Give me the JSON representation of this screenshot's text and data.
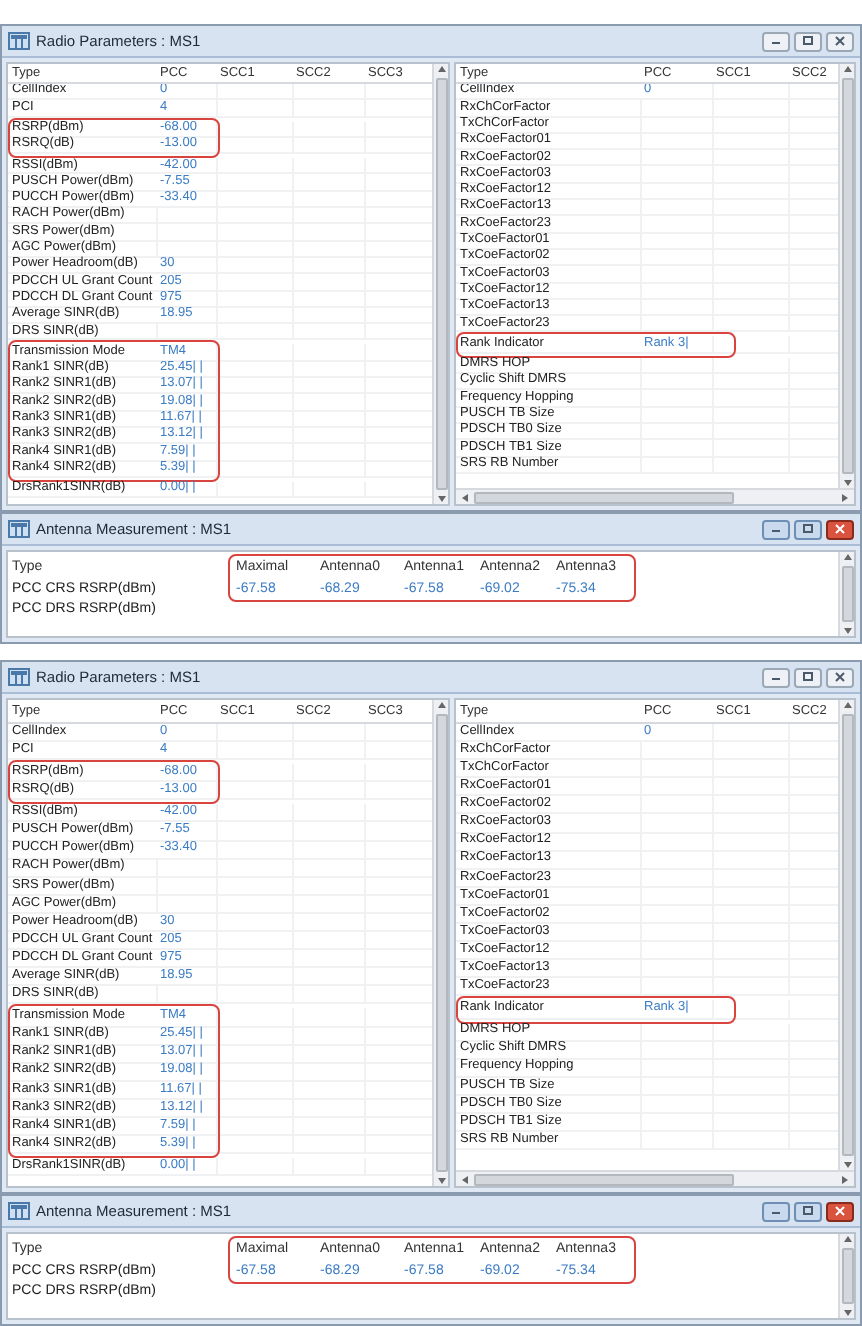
{
  "screens": [
    {
      "radio_parameters": {
        "title": "Radio Parameters : MS1",
        "left_table": {
          "columns": [
            "Type",
            "PCC",
            "SCC1",
            "SCC2",
            "SCC3"
          ],
          "sections": [
            {
              "highlighted": false,
              "rows": [
                {
                  "type": "CellIndex",
                  "pcc": "0"
                },
                {
                  "type": "PCI",
                  "pcc": "4"
                }
              ]
            },
            {
              "highlighted": true,
              "rows": [
                {
                  "type": "RSRP(dBm)",
                  "pcc": "-68.00"
                },
                {
                  "type": "RSRQ(dB)",
                  "pcc": "-13.00"
                }
              ]
            },
            {
              "highlighted": false,
              "rows": [
                {
                  "type": "RSSI(dBm)",
                  "pcc": "-42.00"
                },
                {
                  "type": "PUSCH Power(dBm)",
                  "pcc": "-7.55"
                },
                {
                  "type": "PUCCH Power(dBm)",
                  "pcc": "-33.40"
                },
                {
                  "type": "RACH Power(dBm)"
                },
                {
                  "type": "SRS Power(dBm)"
                },
                {
                  "type": "AGC Power(dBm)"
                },
                {
                  "type": "Power Headroom(dB)",
                  "pcc": "30"
                },
                {
                  "type": "PDCCH UL Grant Count",
                  "pcc": "205"
                },
                {
                  "type": "PDCCH DL Grant Count",
                  "pcc": "975"
                },
                {
                  "type": "Average SINR(dB)",
                  "pcc": "18.95"
                },
                {
                  "type": "DRS SINR(dB)"
                }
              ]
            },
            {
              "highlighted": true,
              "rows": [
                {
                  "type": "Transmission Mode",
                  "pcc": "TM4"
                },
                {
                  "type": "Rank1 SINR(dB)",
                  "pcc": "25.45| |"
                },
                {
                  "type": "Rank2 SINR1(dB)",
                  "pcc": "13.07| |"
                },
                {
                  "type": "Rank2 SINR2(dB)",
                  "pcc": "19.08| |"
                },
                {
                  "type": "Rank3 SINR1(dB)",
                  "pcc": "11.67| |"
                },
                {
                  "type": "Rank3 SINR2(dB)",
                  "pcc": "13.12| |"
                },
                {
                  "type": "Rank4 SINR1(dB)",
                  "pcc": "7.59| |"
                },
                {
                  "type": "Rank4 SINR2(dB)",
                  "pcc": "5.39| |"
                }
              ]
            },
            {
              "highlighted": false,
              "rows": [
                {
                  "type": "DrsRank1SINR(dB)",
                  "pcc": "0.00| |"
                }
              ]
            }
          ]
        },
        "right_table": {
          "columns": [
            "Type",
            "PCC",
            "SCC1",
            "SCC2"
          ],
          "sections": [
            {
              "highlighted": false,
              "rows": [
                {
                  "type": "CellIndex",
                  "pcc": "0"
                },
                {
                  "type": "RxChCorFactor"
                },
                {
                  "type": "TxChCorFactor"
                },
                {
                  "type": "RxCoeFactor01"
                },
                {
                  "type": "RxCoeFactor02"
                },
                {
                  "type": "RxCoeFactor03"
                },
                {
                  "type": "RxCoeFactor12"
                },
                {
                  "type": "RxCoeFactor13"
                },
                {
                  "type": "RxCoeFactor23"
                },
                {
                  "type": "TxCoeFactor01"
                },
                {
                  "type": "TxCoeFactor02"
                },
                {
                  "type": "TxCoeFactor03"
                },
                {
                  "type": "TxCoeFactor12"
                },
                {
                  "type": "TxCoeFactor13"
                },
                {
                  "type": "TxCoeFactor23"
                }
              ]
            },
            {
              "highlighted": true,
              "rows": [
                {
                  "type": "Rank Indicator",
                  "pcc": "Rank 3|"
                }
              ]
            },
            {
              "highlighted": false,
              "rows": [
                {
                  "type": "DMRS HOP"
                },
                {
                  "type": "Cyclic Shift DMRS"
                },
                {
                  "type": "Frequency Hopping"
                },
                {
                  "type": "PUSCH TB Size"
                },
                {
                  "type": "PDSCH TB0 Size"
                },
                {
                  "type": "PDSCH TB1 Size"
                },
                {
                  "type": "SRS RB Number"
                }
              ]
            }
          ]
        }
      },
      "antenna_measurement": {
        "title": "Antenna Measurement : MS1",
        "columns": [
          "Type",
          "Maximal",
          "Antenna0",
          "Antenna1",
          "Antenna2",
          "Antenna3"
        ],
        "values_highlighted": true,
        "rows": [
          {
            "type": "PCC CRS RSRP(dBm)",
            "values": [
              "-67.58",
              "-68.29",
              "-67.58",
              "-69.02",
              "-75.34"
            ]
          },
          {
            "type": "PCC DRS RSRP(dBm)",
            "values": []
          }
        ]
      }
    },
    {
      "radio_parameters": {
        "title": "Radio Parameters : MS1",
        "left_table": {
          "columns": [
            "Type",
            "PCC",
            "SCC1",
            "SCC2",
            "SCC3"
          ],
          "sections": [
            {
              "highlighted": false,
              "rows": [
                {
                  "type": "CellIndex",
                  "pcc": "0"
                },
                {
                  "type": "PCI",
                  "pcc": "4"
                }
              ]
            },
            {
              "highlighted": true,
              "rows": [
                {
                  "type": "RSRP(dBm)",
                  "pcc": "-68.00"
                },
                {
                  "type": "RSRQ(dB)",
                  "pcc": "-13.00"
                }
              ]
            },
            {
              "highlighted": false,
              "rows": [
                {
                  "type": "RSSI(dBm)",
                  "pcc": "-42.00"
                },
                {
                  "type": "PUSCH Power(dBm)",
                  "pcc": "-7.55"
                },
                {
                  "type": "PUCCH Power(dBm)",
                  "pcc": "-33.40"
                },
                {
                  "type": "RACH Power(dBm)"
                },
                {
                  "type": "SRS Power(dBm)"
                },
                {
                  "type": "AGC Power(dBm)"
                },
                {
                  "type": "Power Headroom(dB)",
                  "pcc": "30"
                },
                {
                  "type": "PDCCH UL Grant Count",
                  "pcc": "205"
                },
                {
                  "type": "PDCCH DL Grant Count",
                  "pcc": "975"
                },
                {
                  "type": "Average SINR(dB)",
                  "pcc": "18.95"
                },
                {
                  "type": "DRS SINR(dB)"
                }
              ]
            },
            {
              "highlighted": true,
              "rows": [
                {
                  "type": "Transmission Mode",
                  "pcc": "TM4"
                },
                {
                  "type": "Rank1 SINR(dB)",
                  "pcc": "25.45| |"
                },
                {
                  "type": "Rank2 SINR1(dB)",
                  "pcc": "13.07| |"
                },
                {
                  "type": "Rank2 SINR2(dB)",
                  "pcc": "19.08| |"
                },
                {
                  "type": "Rank3 SINR1(dB)",
                  "pcc": "11.67| |"
                },
                {
                  "type": "Rank3 SINR2(dB)",
                  "pcc": "13.12| |"
                },
                {
                  "type": "Rank4 SINR1(dB)",
                  "pcc": "7.59| |"
                },
                {
                  "type": "Rank4 SINR2(dB)",
                  "pcc": "5.39| |"
                }
              ]
            },
            {
              "highlighted": false,
              "rows": [
                {
                  "type": "DrsRank1SINR(dB)",
                  "pcc": "0.00| |"
                }
              ]
            }
          ]
        },
        "right_table": {
          "columns": [
            "Type",
            "PCC",
            "SCC1",
            "SCC2"
          ],
          "sections": [
            {
              "highlighted": false,
              "rows": [
                {
                  "type": "CellIndex",
                  "pcc": "0"
                },
                {
                  "type": "RxChCorFactor"
                },
                {
                  "type": "TxChCorFactor"
                },
                {
                  "type": "RxCoeFactor01"
                },
                {
                  "type": "RxCoeFactor02"
                },
                {
                  "type": "RxCoeFactor03"
                },
                {
                  "type": "RxCoeFactor12"
                },
                {
                  "type": "RxCoeFactor13"
                },
                {
                  "type": "RxCoeFactor23"
                },
                {
                  "type": "TxCoeFactor01"
                },
                {
                  "type": "TxCoeFactor02"
                },
                {
                  "type": "TxCoeFactor03"
                },
                {
                  "type": "TxCoeFactor12"
                },
                {
                  "type": "TxCoeFactor13"
                },
                {
                  "type": "TxCoeFactor23"
                }
              ]
            },
            {
              "highlighted": true,
              "rows": [
                {
                  "type": "Rank Indicator",
                  "pcc": "Rank 3|"
                }
              ]
            },
            {
              "highlighted": false,
              "rows": [
                {
                  "type": "DMRS HOP"
                },
                {
                  "type": "Cyclic Shift DMRS"
                },
                {
                  "type": "Frequency Hopping"
                },
                {
                  "type": "PUSCH TB Size"
                },
                {
                  "type": "PDSCH TB0 Size"
                },
                {
                  "type": "PDSCH TB1 Size"
                },
                {
                  "type": "SRS RB Number"
                }
              ]
            }
          ]
        }
      },
      "antenna_measurement": {
        "title": "Antenna Measurement : MS1",
        "columns": [
          "Type",
          "Maximal",
          "Antenna0",
          "Antenna1",
          "Antenna2",
          "Antenna3"
        ],
        "values_highlighted": true,
        "rows": [
          {
            "type": "PCC CRS RSRP(dBm)",
            "values": [
              "-67.58",
              "-68.29",
              "-67.58",
              "-69.02",
              "-75.34"
            ]
          },
          {
            "type": "PCC DRS RSRP(dBm)",
            "values": []
          }
        ]
      }
    }
  ]
}
